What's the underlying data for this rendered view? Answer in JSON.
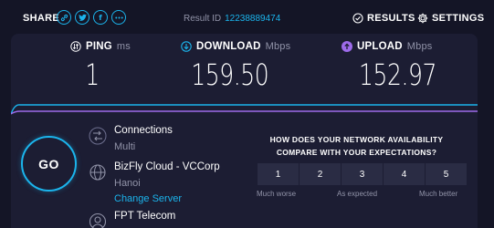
{
  "topbar": {
    "share_label": "SHARE",
    "share_icons": [
      "link-icon",
      "twitter-icon",
      "facebook-icon",
      "more-icon"
    ],
    "result_id_label": "Result ID",
    "result_id_value": "12238889474",
    "results_label": "RESULTS",
    "settings_label": "SETTINGS"
  },
  "metrics": {
    "ping": {
      "label": "PING",
      "unit": "ms",
      "value": "1"
    },
    "download": {
      "label": "DOWNLOAD",
      "unit": "Mbps",
      "value": "159.50"
    },
    "upload": {
      "label": "UPLOAD",
      "unit": "Mbps",
      "value": "152.97"
    }
  },
  "go_label": "GO",
  "connections": {
    "title": "Connections",
    "mode": "Multi"
  },
  "server": {
    "name": "BizFly Cloud - VCCorp",
    "location": "Hanoi",
    "change_label": "Change Server"
  },
  "provider": {
    "name": "FPT Telecom"
  },
  "survey": {
    "question": "HOW DOES YOUR NETWORK AVAILABILITY COMPARE WITH YOUR EXPECTATIONS?",
    "options": [
      "1",
      "2",
      "3",
      "4",
      "5"
    ],
    "scale_low": "Much worse",
    "scale_mid": "As expected",
    "scale_high": "Much better"
  },
  "colors": {
    "accent": "#1bb4ec",
    "download": "#1bb4ec",
    "upload": "#9d6bea",
    "background": "#141526",
    "panel": "#1c1d33"
  }
}
